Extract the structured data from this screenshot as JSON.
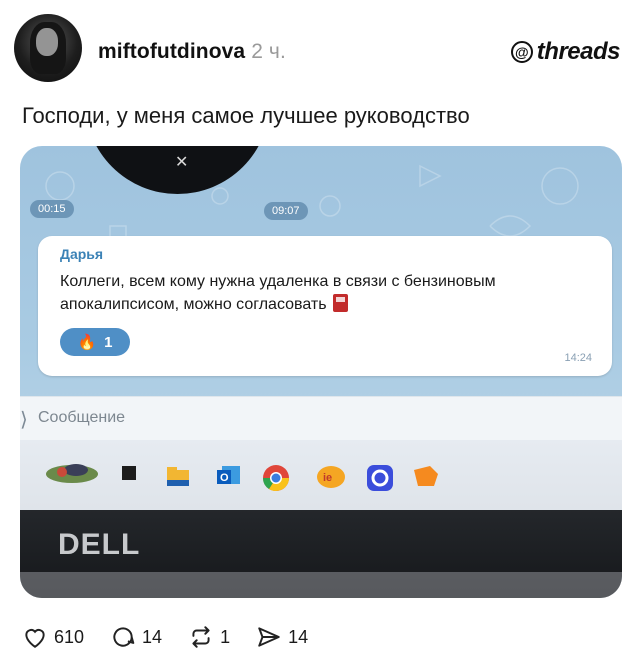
{
  "post": {
    "username": "miftofutdinova",
    "time": "2 ч.",
    "brand": "threads",
    "text": "Господи, у меня самое лучшее руководство"
  },
  "photo": {
    "left_pill": "00:15",
    "center_pill": "09:07",
    "message": {
      "sender": "Дарья",
      "text": "Коллеги, всем кому нужна удаленка в связи с бензиновым апокалипсисом, можно согласовать",
      "reaction_count": "1",
      "time": "14:24"
    },
    "input_placeholder": "Сообщение",
    "monitor_brand": "DELL"
  },
  "actions": {
    "likes": "610",
    "comments": "14",
    "reposts": "1",
    "shares": "14"
  },
  "icons": [
    "heart-icon",
    "comment-icon",
    "repost-icon",
    "share-icon",
    "threads-logo-icon",
    "fire-icon",
    "fuel-pump-icon"
  ]
}
